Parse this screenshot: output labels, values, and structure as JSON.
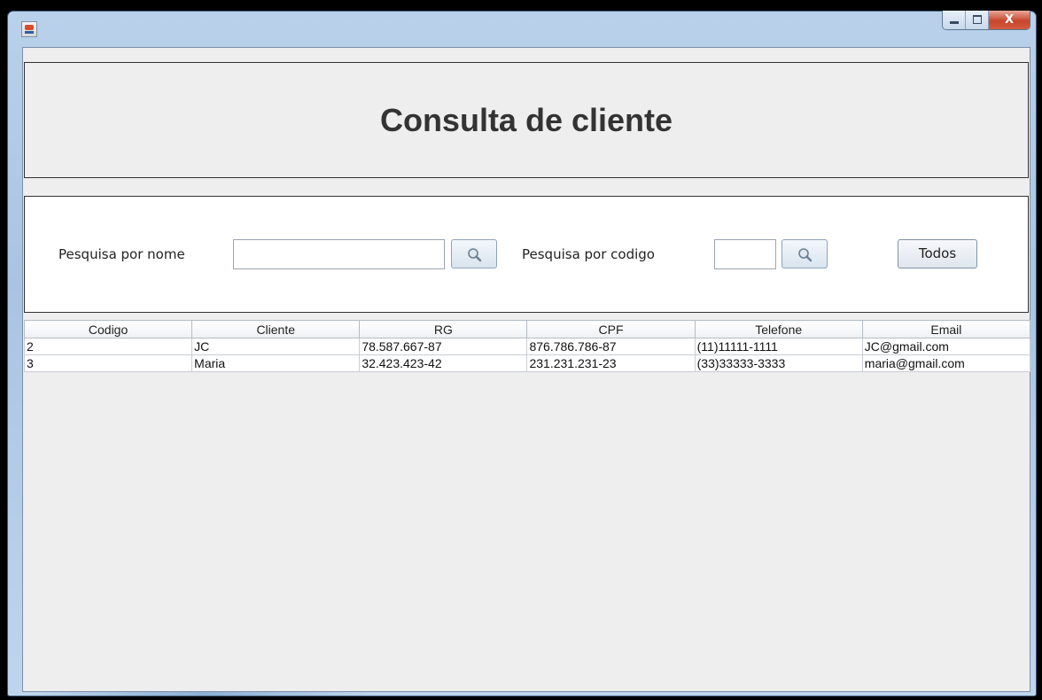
{
  "window": {
    "title": ""
  },
  "header": {
    "title": "Consulta de cliente"
  },
  "search": {
    "name_label": "Pesquisa por nome",
    "name_value": "",
    "code_label": "Pesquisa por codigo",
    "code_value": "",
    "all_button": "Todos",
    "search_icon": "magnifier-icon"
  },
  "table": {
    "columns": [
      "Codigo",
      "Cliente",
      "RG",
      "CPF",
      "Telefone",
      "Email"
    ],
    "rows": [
      [
        "2",
        "JC",
        "78.587.667-87",
        "876.786.786-87",
        "(11)11111-1111",
        "JC@gmail.com"
      ],
      [
        "3",
        "Maria",
        "32.423.423-42",
        "231.231.231-23",
        "(33)33333-3333",
        "maria@gmail.com"
      ]
    ]
  },
  "colors": {
    "close_button": "#c8462d",
    "titlebar": "#b9d1ea",
    "panel_bg": "#eeeeee"
  }
}
